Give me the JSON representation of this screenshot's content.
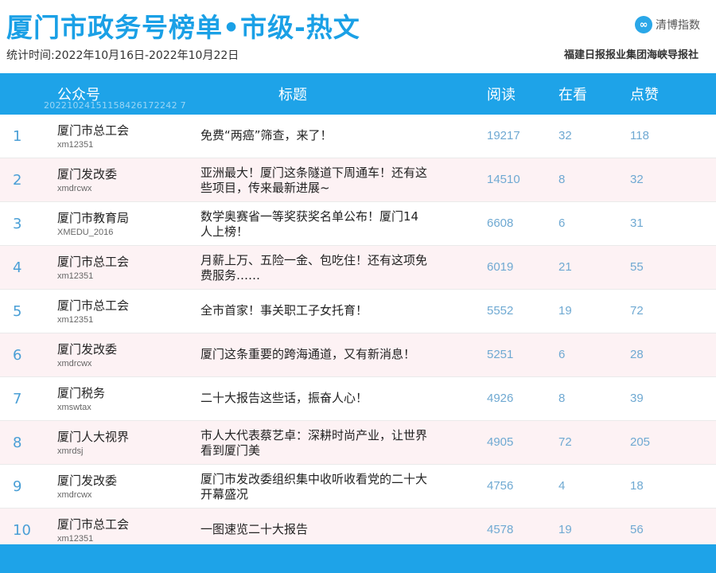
{
  "header": {
    "title": "厦门市政务号榜单•市级-热文",
    "period": "统计时间:2022年10月16日-2022年10月22日",
    "logo_text": "清博指数",
    "publisher": "福建日报报业集团海峡导报社"
  },
  "table": {
    "columns": [
      "公众号",
      "标题",
      "阅读",
      "在看",
      "点赞"
    ],
    "id_watermark": "20221024151158426172242 7",
    "rows": [
      {
        "rank": "1",
        "account": "厦门市总工会",
        "account_id": "xm12351",
        "title": "免费“两癌”筛查，来了！",
        "reads": "19217",
        "watching": "32",
        "likes": "118"
      },
      {
        "rank": "2",
        "account": "厦门发改委",
        "account_id": "xmdrcwx",
        "title": "亚洲最大！厦门这条隧道下周通车！还有这些项目，传来最新进展~",
        "reads": "14510",
        "watching": "8",
        "likes": "32"
      },
      {
        "rank": "3",
        "account": "厦门市教育局",
        "account_id": "XMEDU_2016",
        "title": "数学奥赛省一等奖获奖名单公布！厦门14人上榜！",
        "reads": "6608",
        "watching": "6",
        "likes": "31"
      },
      {
        "rank": "4",
        "account": "厦门市总工会",
        "account_id": "xm12351",
        "title": "月薪上万、五险一金、包吃住！还有这项免费服务……",
        "reads": "6019",
        "watching": "21",
        "likes": "55"
      },
      {
        "rank": "5",
        "account": "厦门市总工会",
        "account_id": "xm12351",
        "title": "全市首家！事关职工子女托育！",
        "reads": "5552",
        "watching": "19",
        "likes": "72"
      },
      {
        "rank": "6",
        "account": "厦门发改委",
        "account_id": "xmdrcwx",
        "title": "厦门这条重要的跨海通道，又有新消息！",
        "reads": "5251",
        "watching": "6",
        "likes": "28"
      },
      {
        "rank": "7",
        "account": "厦门税务",
        "account_id": "xmswtax",
        "title": "二十大报告这些话，振奋人心！",
        "reads": "4926",
        "watching": "8",
        "likes": "39"
      },
      {
        "rank": "8",
        "account": "厦门人大视界",
        "account_id": "xmrdsj",
        "title": "市人大代表蔡艺卓：深耕时尚产业，让世界看到厦门美",
        "reads": "4905",
        "watching": "72",
        "likes": "205"
      },
      {
        "rank": "9",
        "account": "厦门发改委",
        "account_id": "xmdrcwx",
        "title": "厦门市发改委组织集中收听收看党的二十大开幕盛况",
        "reads": "4756",
        "watching": "4",
        "likes": "18"
      },
      {
        "rank": "10",
        "account": "厦门市总工会",
        "account_id": "xm12351",
        "title": "一图速览二十大报告",
        "reads": "4578",
        "watching": "19",
        "likes": "56"
      }
    ]
  },
  "colors": {
    "accent": "#1ea3e8",
    "row_alt": "#fdf2f4",
    "rank": "#4a9fd6",
    "numbers": "#6fa9d2"
  }
}
